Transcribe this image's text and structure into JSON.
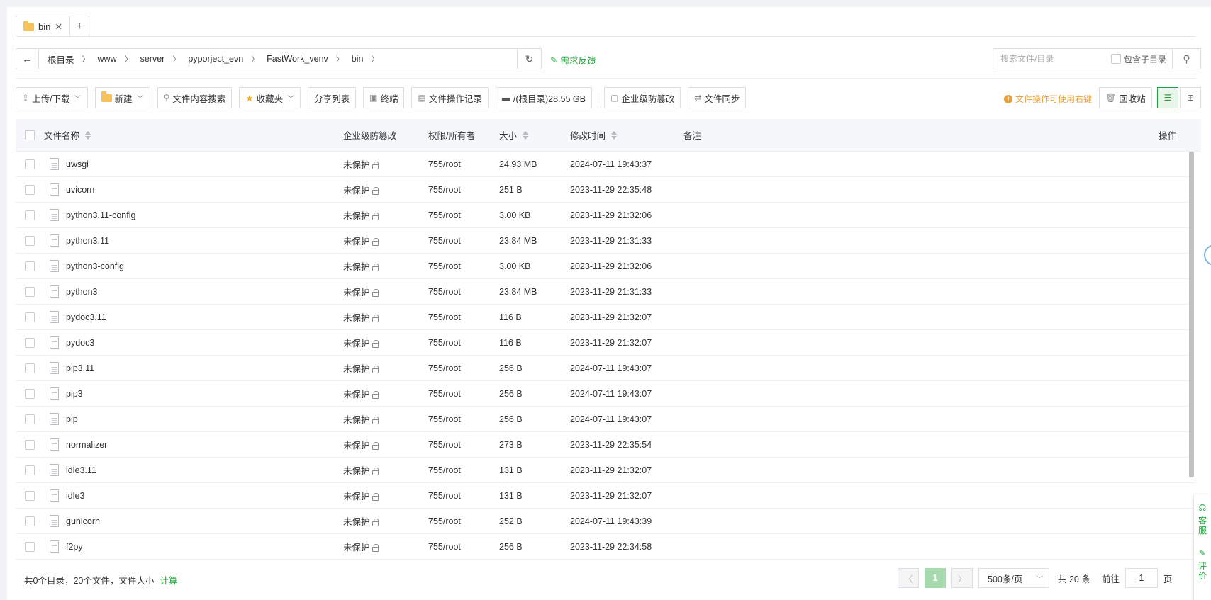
{
  "tabs": [
    {
      "label": "bin"
    }
  ],
  "address": {
    "crumbs": [
      "根目录",
      "www",
      "server",
      "pyporject_evn",
      "FastWork_venv",
      "bin"
    ]
  },
  "feedback_label": "需求反馈",
  "search": {
    "placeholder": "搜索文件/目录",
    "subdir_label": "包含子目录"
  },
  "toolbar": {
    "upload": "上传/下载",
    "new": "新建",
    "content_search": "文件内容搜索",
    "favorites": "收藏夹",
    "share_list": "分享列表",
    "terminal": "终端",
    "op_log": "文件操作记录",
    "disk": "/(根目录)28.55 GB",
    "tamper": "企业级防篡改",
    "sync": "文件同步",
    "tip": "文件操作可使用右键",
    "recycle": "回收站"
  },
  "table": {
    "headers": {
      "name": "文件名称",
      "protect": "企业级防篡改",
      "perm": "权限/所有者",
      "size": "大小",
      "mtime": "修改时间",
      "note": "备注",
      "op": "操作"
    },
    "rows": [
      {
        "name": "uwsgi",
        "protect": "未保护",
        "perm": "755/root",
        "size": "24.93 MB",
        "mtime": "2024-07-11 19:43:37"
      },
      {
        "name": "uvicorn",
        "protect": "未保护",
        "perm": "755/root",
        "size": "251 B",
        "mtime": "2023-11-29 22:35:48"
      },
      {
        "name": "python3.11-config",
        "protect": "未保护",
        "perm": "755/root",
        "size": "3.00 KB",
        "mtime": "2023-11-29 21:32:06"
      },
      {
        "name": "python3.11",
        "protect": "未保护",
        "perm": "755/root",
        "size": "23.84 MB",
        "mtime": "2023-11-29 21:31:33"
      },
      {
        "name": "python3-config",
        "protect": "未保护",
        "perm": "755/root",
        "size": "3.00 KB",
        "mtime": "2023-11-29 21:32:06"
      },
      {
        "name": "python3",
        "protect": "未保护",
        "perm": "755/root",
        "size": "23.84 MB",
        "mtime": "2023-11-29 21:31:33"
      },
      {
        "name": "pydoc3.11",
        "protect": "未保护",
        "perm": "755/root",
        "size": "116 B",
        "mtime": "2023-11-29 21:32:07"
      },
      {
        "name": "pydoc3",
        "protect": "未保护",
        "perm": "755/root",
        "size": "116 B",
        "mtime": "2023-11-29 21:32:07"
      },
      {
        "name": "pip3.11",
        "protect": "未保护",
        "perm": "755/root",
        "size": "256 B",
        "mtime": "2024-07-11 19:43:07"
      },
      {
        "name": "pip3",
        "protect": "未保护",
        "perm": "755/root",
        "size": "256 B",
        "mtime": "2024-07-11 19:43:07"
      },
      {
        "name": "pip",
        "protect": "未保护",
        "perm": "755/root",
        "size": "256 B",
        "mtime": "2024-07-11 19:43:07"
      },
      {
        "name": "normalizer",
        "protect": "未保护",
        "perm": "755/root",
        "size": "273 B",
        "mtime": "2023-11-29 22:35:54"
      },
      {
        "name": "idle3.11",
        "protect": "未保护",
        "perm": "755/root",
        "size": "131 B",
        "mtime": "2023-11-29 21:32:07"
      },
      {
        "name": "idle3",
        "protect": "未保护",
        "perm": "755/root",
        "size": "131 B",
        "mtime": "2023-11-29 21:32:07"
      },
      {
        "name": "gunicorn",
        "protect": "未保护",
        "perm": "755/root",
        "size": "252 B",
        "mtime": "2024-07-11 19:43:39"
      },
      {
        "name": "f2py",
        "protect": "未保护",
        "perm": "755/root",
        "size": "256 B",
        "mtime": "2023-11-29 22:34:58"
      }
    ]
  },
  "footer": {
    "summary": "共0个目录，20个文件，文件大小",
    "calc": "计算"
  },
  "pager": {
    "current": "1",
    "per_page": "500条/页",
    "total": "共 20 条",
    "goto_prefix": "前往",
    "goto_value": "1",
    "goto_suffix": "页"
  },
  "side_widget": {
    "service": [
      "客",
      "服"
    ],
    "review": [
      "评",
      "价"
    ]
  }
}
